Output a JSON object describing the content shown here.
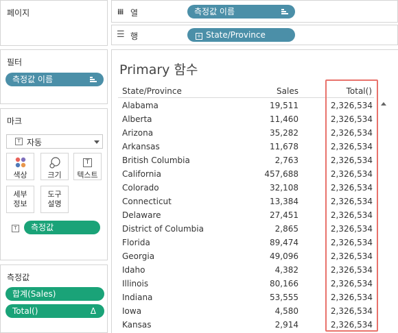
{
  "left": {
    "pages_label": "페이지",
    "filters_label": "필터",
    "filter_pill": "측정값 이름",
    "marks_label": "마크",
    "mark_type": "자동",
    "mark_buttons": {
      "color": "색상",
      "size": "크기",
      "text": "텍스트",
      "detail": "세부\n정보",
      "tooltip": "도구\n설명"
    },
    "mark_text_pill": "측정값",
    "measures_label": "측정값",
    "measure_pills": [
      "합계(Sales)",
      "Total()"
    ],
    "delta_symbol": "Δ"
  },
  "shelves": {
    "columns_label": "열",
    "columns_pill": "측정값 이름",
    "rows_label": "행",
    "rows_pill": "State/Province"
  },
  "view": {
    "title": "Primary 함수",
    "headers": {
      "state": "State/Province",
      "sales": "Sales",
      "total": "Total()"
    },
    "rows": [
      {
        "state": "Alabama",
        "sales": "19,511",
        "total": "2,326,534"
      },
      {
        "state": "Alberta",
        "sales": "11,460",
        "total": "2,326,534"
      },
      {
        "state": "Arizona",
        "sales": "35,282",
        "total": "2,326,534"
      },
      {
        "state": "Arkansas",
        "sales": "11,678",
        "total": "2,326,534"
      },
      {
        "state": "British Columbia",
        "sales": "2,763",
        "total": "2,326,534"
      },
      {
        "state": "California",
        "sales": "457,688",
        "total": "2,326,534"
      },
      {
        "state": "Colorado",
        "sales": "32,108",
        "total": "2,326,534"
      },
      {
        "state": "Connecticut",
        "sales": "13,384",
        "total": "2,326,534"
      },
      {
        "state": "Delaware",
        "sales": "27,451",
        "total": "2,326,534"
      },
      {
        "state": "District of Columbia",
        "sales": "2,865",
        "total": "2,326,534"
      },
      {
        "state": "Florida",
        "sales": "89,474",
        "total": "2,326,534"
      },
      {
        "state": "Georgia",
        "sales": "49,096",
        "total": "2,326,534"
      },
      {
        "state": "Idaho",
        "sales": "4,382",
        "total": "2,326,534"
      },
      {
        "state": "Illinois",
        "sales": "80,166",
        "total": "2,326,534"
      },
      {
        "state": "Indiana",
        "sales": "53,555",
        "total": "2,326,534"
      },
      {
        "state": "Iowa",
        "sales": "4,580",
        "total": "2,326,534"
      },
      {
        "state": "Kansas",
        "sales": "2,914",
        "total": "2,326,534"
      }
    ]
  },
  "colors": {
    "measure_names_pill": "#4b8fa8",
    "measure_pill": "#1aa378",
    "highlight": "#e8726b"
  }
}
